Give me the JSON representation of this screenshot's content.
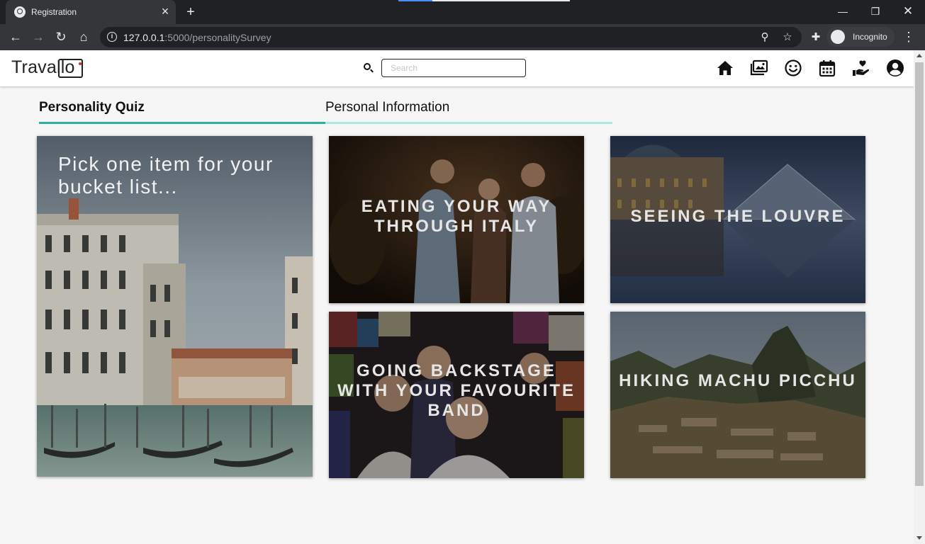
{
  "browser": {
    "tab_title": "Registration",
    "url_host": "127.0.0.1",
    "url_rest": ":5000/personalitySurvey",
    "profile_label": "Incognito"
  },
  "header": {
    "logo_text": "Travallo",
    "search_placeholder": "Search",
    "nav_icons": [
      "home-icon",
      "gallery-icon",
      "smiley-icon",
      "calendar-icon",
      "hand-heart-icon",
      "account-icon"
    ]
  },
  "tabs": {
    "active": "Personality Quiz",
    "inactive": "Personal Information"
  },
  "quiz": {
    "prompt": "Pick one item for your bucket list...",
    "options": [
      {
        "label": "Eating your way through Italy"
      },
      {
        "label": "Seeing the Louvre"
      },
      {
        "label": "Going backstage with your favourite band"
      },
      {
        "label": "Hiking Machu Picchu"
      }
    ]
  },
  "colors": {
    "accent": "#2bb0a0",
    "accent_light": "#a9e9df",
    "chrome_dark": "#202124",
    "chrome_mid": "#35363a"
  }
}
